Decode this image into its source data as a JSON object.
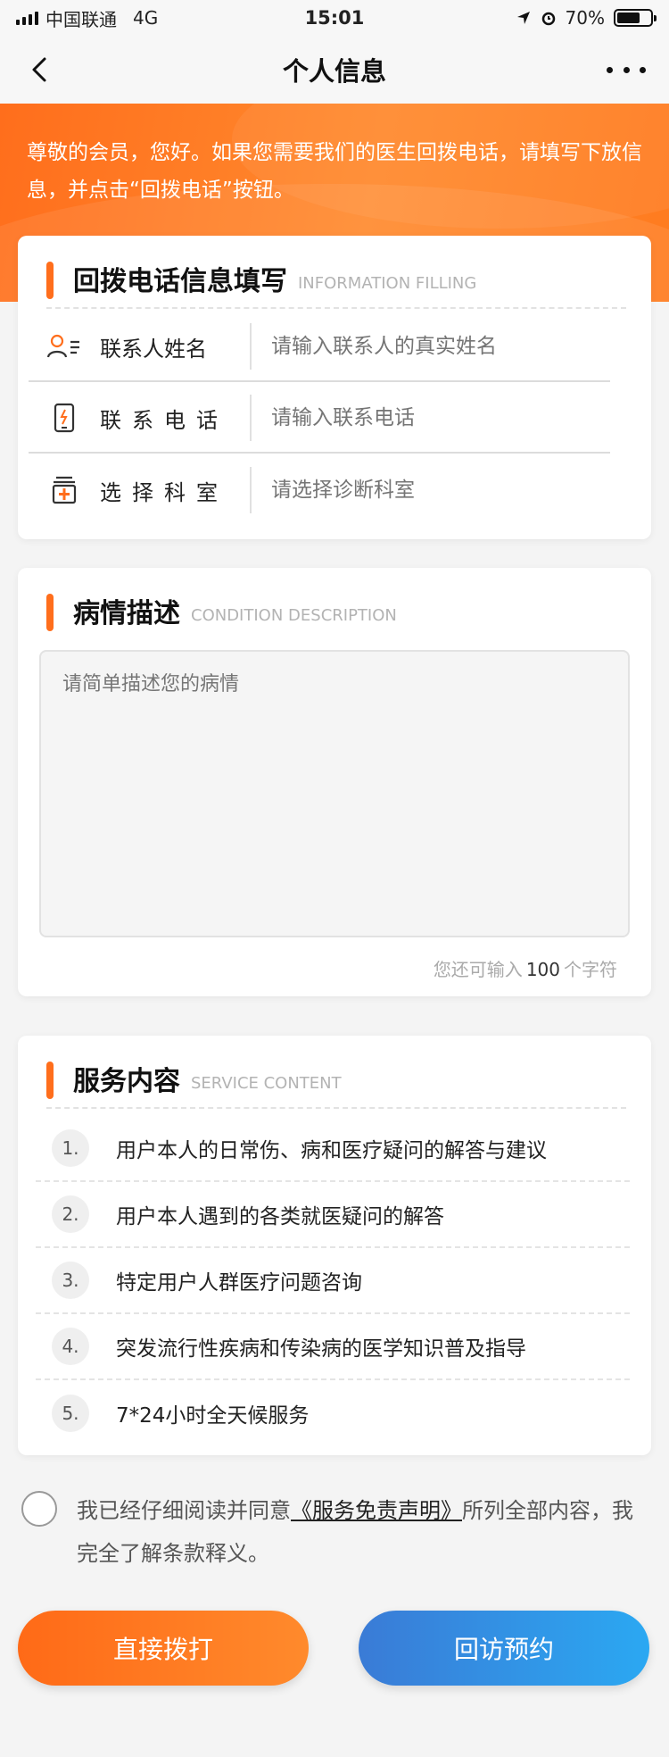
{
  "status_bar": {
    "carrier": "中国联通",
    "network": "4G",
    "time": "15:01",
    "battery": "70%",
    "battery_level": 0.7
  },
  "nav": {
    "title": "个人信息"
  },
  "banner": {
    "text": "尊敬的会员，您好。如果您需要我们的医生回拨电话，请填写下放信息，并点击“回拨电话”按钮。"
  },
  "callback_card": {
    "title": "回拨电话信息填写",
    "subtitle": "INFORMATION FILLING",
    "fields": [
      {
        "icon": "contact-person-icon",
        "label": "联系人姓名",
        "placeholder": "请输入联系人的真实姓名"
      },
      {
        "icon": "phone-icon",
        "label": "联系电话",
        "placeholder": "请输入联系电话"
      },
      {
        "icon": "department-icon",
        "label": "选择科室",
        "placeholder": "请选择诊断科室"
      }
    ]
  },
  "condition_card": {
    "title": "病情描述",
    "subtitle": "CONDITION DESCRIPTION",
    "placeholder": "请简单描述您的病情",
    "counter_prefix": "您还可输入",
    "counter_value": "100",
    "counter_suffix": "个字符"
  },
  "service_card": {
    "title": "服务内容",
    "subtitle": "SERVICE CONTENT",
    "items": [
      {
        "num": "1.",
        "text": "用户本人的日常伤、病和医疗疑问的解答与建议"
      },
      {
        "num": "2.",
        "text": "用户本人遇到的各类就医疑问的解答"
      },
      {
        "num": "3.",
        "text": "特定用户人群医疗问题咨询"
      },
      {
        "num": "4.",
        "text": "突发流行性疾病和传染病的医学知识普及指导"
      },
      {
        "num": "5.",
        "text": "7*24小时全天候服务"
      }
    ]
  },
  "agreement": {
    "prefix": "我已经仔细阅读并同意",
    "link": "《服务免责声明》",
    "suffix": "所列全部内容，我完全了解条款释义。"
  },
  "buttons": {
    "call": "直接拨打",
    "book": "回访预约"
  },
  "colors": {
    "accent": "#ff6e1c",
    "secondary": "#2ba8f2"
  }
}
